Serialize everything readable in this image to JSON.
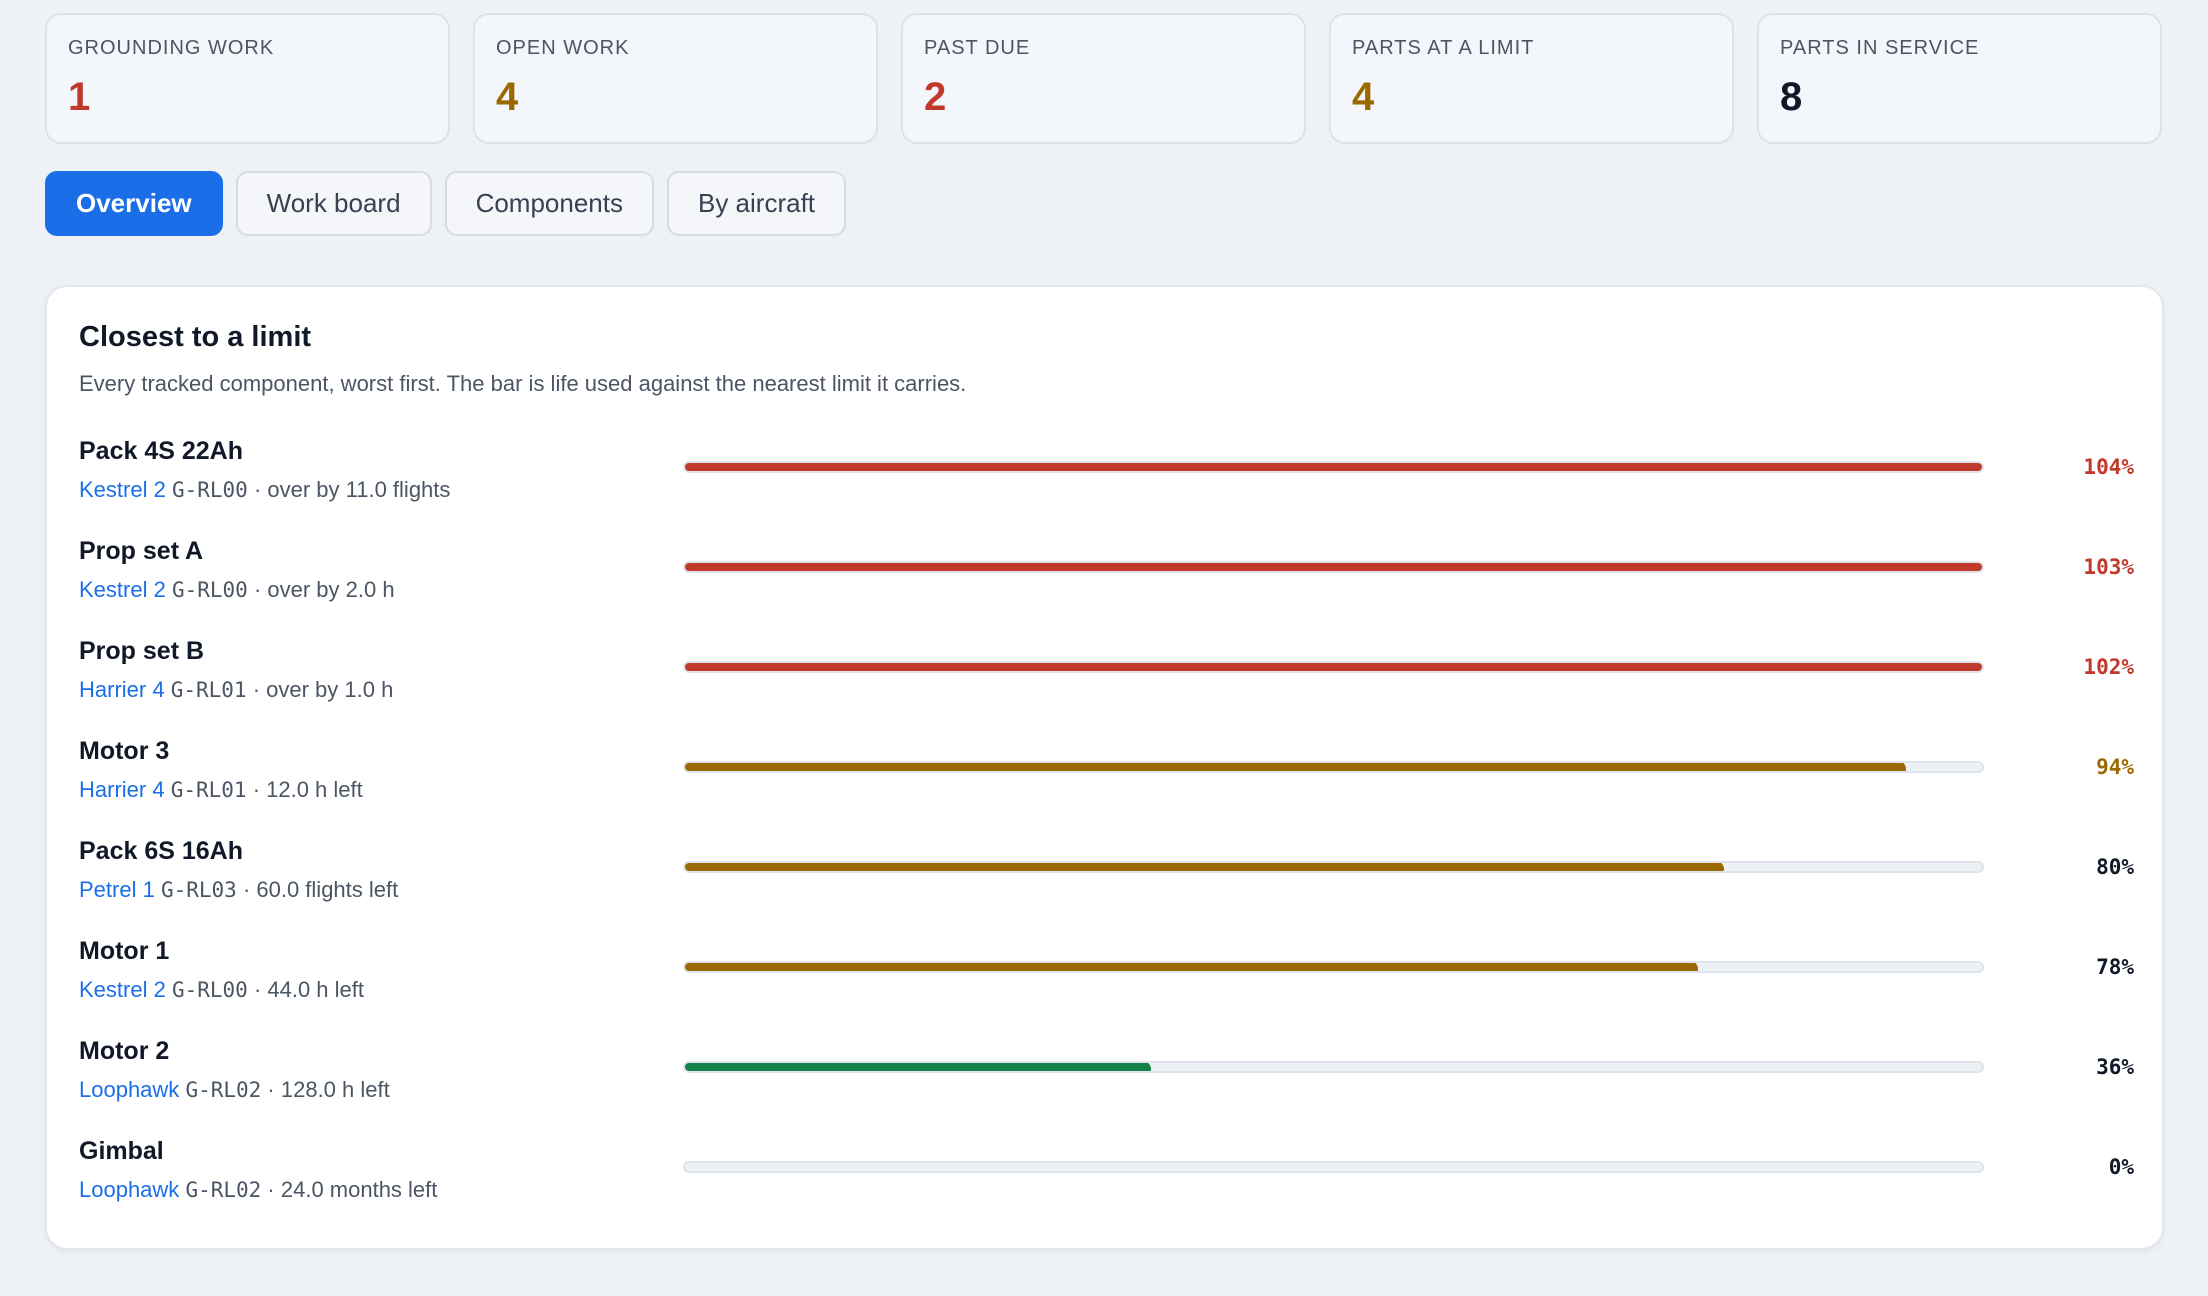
{
  "colors": {
    "red": "#c0392b",
    "amber": "#9a6a00",
    "green": "#14804a",
    "dark": "#111827",
    "accent": "#1a6fe8"
  },
  "stats": [
    {
      "label": "GROUNDING WORK",
      "value": "1",
      "color": "#c0392b"
    },
    {
      "label": "OPEN WORK",
      "value": "4",
      "color": "#9a6a00"
    },
    {
      "label": "PAST DUE",
      "value": "2",
      "color": "#c0392b"
    },
    {
      "label": "PARTS AT A LIMIT",
      "value": "4",
      "color": "#9a6a00"
    },
    {
      "label": "PARTS IN SERVICE",
      "value": "8",
      "color": "#111827"
    }
  ],
  "tabs": [
    {
      "label": "Overview",
      "active": true
    },
    {
      "label": "Work board",
      "active": false
    },
    {
      "label": "Components",
      "active": false
    },
    {
      "label": "By aircraft",
      "active": false
    }
  ],
  "panel": {
    "title": "Closest to a limit",
    "subtitle": "Every tracked component, worst first. The bar is life used against the nearest limit it carries.",
    "rows": [
      {
        "name": "Pack 4S 22Ah",
        "aircraft": "Kestrel 2",
        "reg": "G-RL00",
        "status": "· over by 11.0 flights",
        "percent": "104%",
        "used": 1.04,
        "bar_color": "#c0392b",
        "pct_color": "#c0392b"
      },
      {
        "name": "Prop set A",
        "aircraft": "Kestrel 2",
        "reg": "G-RL00",
        "status": "· over by 2.0 h",
        "percent": "103%",
        "used": 1.03,
        "bar_color": "#c0392b",
        "pct_color": "#c0392b"
      },
      {
        "name": "Prop set B",
        "aircraft": "Harrier 4",
        "reg": "G-RL01",
        "status": "· over by 1.0 h",
        "percent": "102%",
        "used": 1.02,
        "bar_color": "#c0392b",
        "pct_color": "#c0392b"
      },
      {
        "name": "Motor 3",
        "aircraft": "Harrier 4",
        "reg": "G-RL01",
        "status": "· 12.0 h left",
        "percent": "94%",
        "used": 0.94,
        "bar_color": "#9a6a00",
        "pct_color": "#9a6a00"
      },
      {
        "name": "Pack 6S 16Ah",
        "aircraft": "Petrel 1",
        "reg": "G-RL03",
        "status": "· 60.0 flights left",
        "percent": "80%",
        "used": 0.8,
        "bar_color": "#9a6a00",
        "pct_color": "#111827"
      },
      {
        "name": "Motor 1",
        "aircraft": "Kestrel 2",
        "reg": "G-RL00",
        "status": "· 44.0 h left",
        "percent": "78%",
        "used": 0.78,
        "bar_color": "#9a6a00",
        "pct_color": "#111827"
      },
      {
        "name": "Motor 2",
        "aircraft": "Loophawk",
        "reg": "G-RL02",
        "status": "· 128.0 h left",
        "percent": "36%",
        "used": 0.36,
        "bar_color": "#14804a",
        "pct_color": "#111827"
      },
      {
        "name": "Gimbal",
        "aircraft": "Loophawk",
        "reg": "G-RL02",
        "status": "· 24.0 months left",
        "percent": "0%",
        "used": 0.0,
        "bar_color": "#14804a",
        "pct_color": "#111827"
      }
    ]
  }
}
